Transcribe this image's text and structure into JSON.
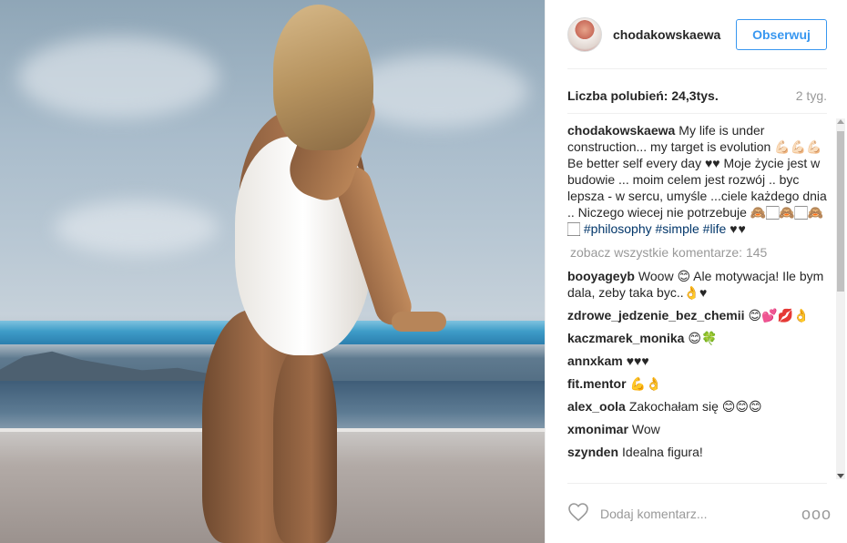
{
  "post": {
    "username": "chodakowskaewa",
    "follow_label": "Obserwuj",
    "likes_text": "Liczba polubień: 24,3tys.",
    "time_ago": "2 tyg.",
    "caption": {
      "user": "chodakowskaewa",
      "text": "My life is under construction... my target is evolution 💪🏻💪🏻💪🏻 Be better self every day ♥♥ Moje życie jest w budowie ... moim celem jest rozwój .. byc lepsza - w sercu, umyśle ...ciele każdego dnia .. Niczego wiecej nie potrzebuje 🙈🏻🙈🏻🙈🏻",
      "tags": [
        "#philosophy",
        "#simple",
        "#life"
      ],
      "tail": "♥♥"
    },
    "view_all": "zobacz wszystkie komentarze: 145",
    "comments": [
      {
        "user": "booyageyb",
        "text": "Woow 😊 Ale motywacja! Ile bym dala, zeby taka byc..👌♥"
      },
      {
        "user": "zdrowe_jedzenie_bez_chemii",
        "text": "😊💕💋👌"
      },
      {
        "user": "kaczmarek_monika",
        "text": "😊🍀"
      },
      {
        "user": "annxkam",
        "text": "♥♥♥"
      },
      {
        "user": "fit.mentor",
        "text": "💪👌"
      },
      {
        "user": "alex_oola",
        "text": "Zakochałam się 😊😊😊"
      },
      {
        "user": "xmonimar",
        "text": "Wow"
      },
      {
        "user": "szynden",
        "text": "Idealna figura!"
      }
    ],
    "add_comment_placeholder": "Dodaj komentarz...",
    "more_label": "ooo"
  },
  "icons": {
    "heart": "heart-icon",
    "more": "more-options-icon"
  },
  "colors": {
    "accent": "#3897f0",
    "tag": "#003569",
    "muted": "#999999"
  }
}
